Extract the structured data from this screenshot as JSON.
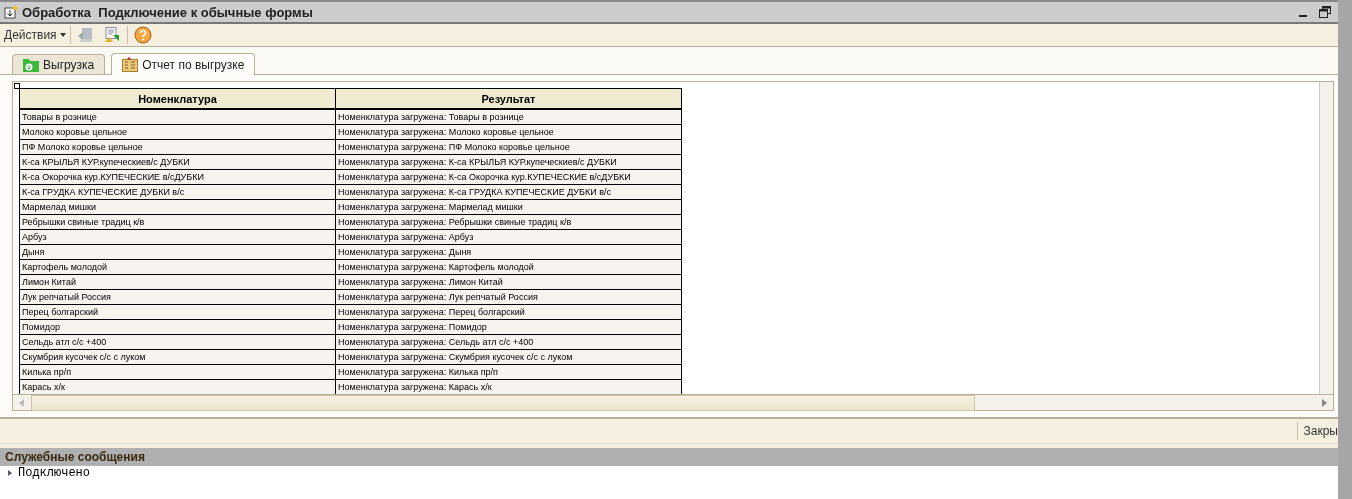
{
  "window": {
    "title": "Обработка  Подключение к обычные формы"
  },
  "toolbar": {
    "actions_menu": "Действия"
  },
  "tabs": [
    {
      "label": "Выгрузка",
      "selected": false,
      "kind": "upload"
    },
    {
      "label": "Отчет по выгрузке",
      "selected": true,
      "kind": "report"
    }
  ],
  "table": {
    "columns": [
      "Номенклатура",
      "Результат"
    ],
    "rows": [
      [
        "Товары в рознице",
        "Номенклатура загружена: Товары в рознице"
      ],
      [
        "Молоко коровье цельное",
        "Номенклатура загружена: Молоко коровье цельное"
      ],
      [
        "ПФ Молоко коровье цельное",
        "Номенклатура загружена: ПФ Молоко коровье цельное"
      ],
      [
        "К-са КРЫЛЬЯ КУР.купеческиев/с ДУБКИ",
        "Номенклатура загружена: К-са КРЫЛЬЯ КУР.купеческиев/с ДУБКИ"
      ],
      [
        "К-са Окорочка кур.КУПЕЧЕСКИЕ в/сДУБКИ",
        "Номенклатура загружена: К-са Окорочка кур.КУПЕЧЕСКИЕ в/сДУБКИ"
      ],
      [
        "К-са ГРУДКА КУПЕЧЕСКИЕ ДУБКИ в/с",
        "Номенклатура загружена: К-са ГРУДКА КУПЕЧЕСКИЕ ДУБКИ в/с"
      ],
      [
        "Мармелад мишки",
        "Номенклатура загружена: Мармелад мишки"
      ],
      [
        "Ребрышки свиные традиц к/в",
        "Номенклатура загружена: Ребрышки свиные традиц к/в"
      ],
      [
        "Арбуз",
        "Номенклатура загружена: Арбуз"
      ],
      [
        "Дыня",
        "Номенклатура загружена: Дыня"
      ],
      [
        "Картофель молодой",
        "Номенклатура загружена: Картофель молодой"
      ],
      [
        "Лимон Китай",
        "Номенклатура загружена: Лимон Китай"
      ],
      [
        "Лук репчатый Россия",
        "Номенклатура загружена: Лук репчатый Россия"
      ],
      [
        "Перец болгарский",
        "Номенклатура загружена: Перец болгарский"
      ],
      [
        "Помидор",
        "Номенклатура загружена: Помидор"
      ],
      [
        "Сельдь атл с/с +400",
        "Номенклатура загружена: Сельдь атл с/с +400"
      ],
      [
        "Скумбрия кусочек с/с с луком",
        "Номенклатура загружена: Скумбрия кусочек с/с с луком"
      ],
      [
        "Килька пр/п",
        "Номенклатура загружена: Килька пр/п"
      ],
      [
        "Карась х/к",
        "Номенклатура загружена: Карась х/к"
      ]
    ]
  },
  "footer": {
    "close_button": "Закры"
  },
  "messages": {
    "title": "Служебные сообщения",
    "items": [
      "Подключено"
    ]
  }
}
